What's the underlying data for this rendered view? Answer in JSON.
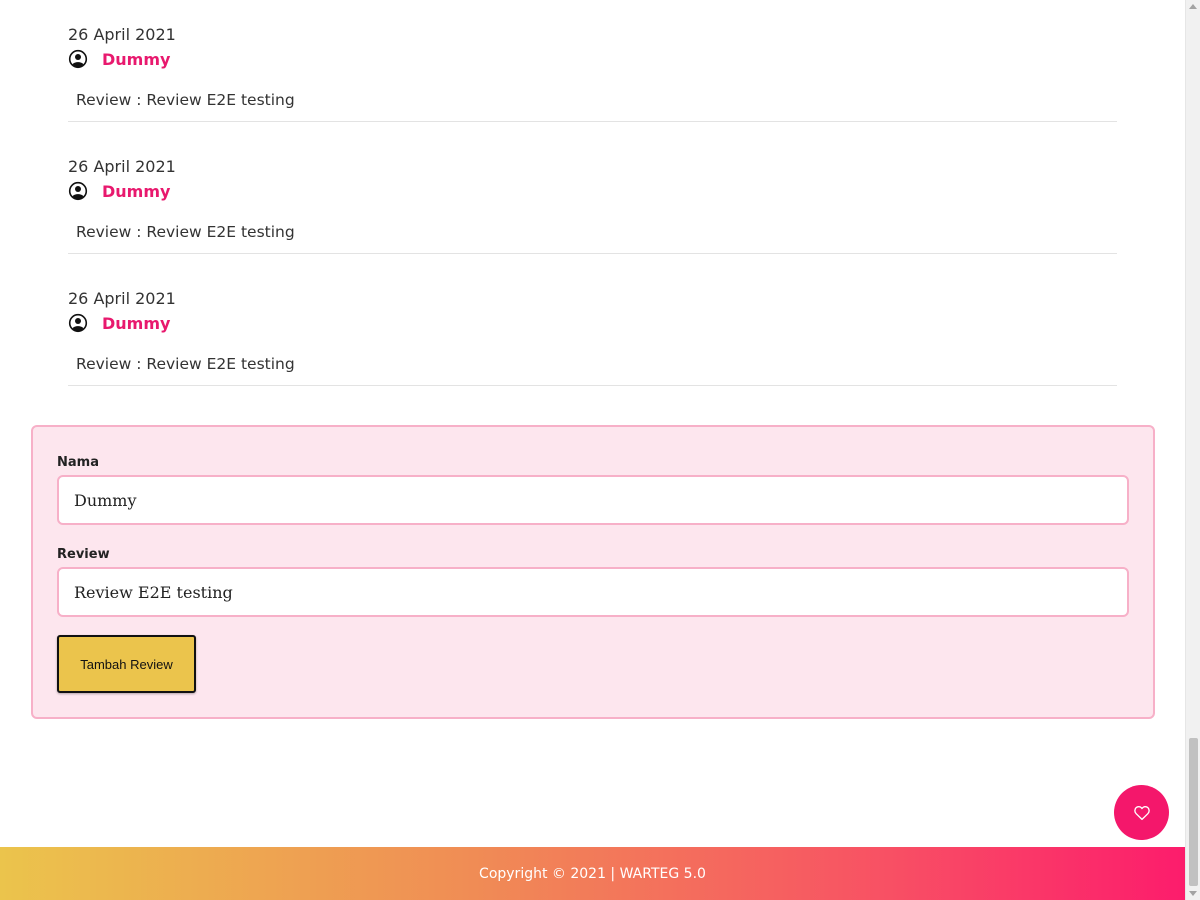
{
  "reviews": [
    {
      "date": "26 April 2021",
      "name": "Dummy",
      "text": "Review : Review E2E testing"
    },
    {
      "date": "26 April 2021",
      "name": "Dummy",
      "text": "Review : Review E2E testing"
    },
    {
      "date": "26 April 2021",
      "name": "Dummy",
      "text": "Review : Review E2E testing"
    }
  ],
  "form": {
    "name_label": "Nama",
    "name_value": "Dummy",
    "review_label": "Review",
    "review_value": "Review E2E testing",
    "submit_label": "Tambah Review"
  },
  "fab": {
    "icon": "heart-icon"
  },
  "footer": {
    "text": "Copyright © 2021 | WARTEG 5.0"
  },
  "colors": {
    "accent": "#e8196e",
    "form_bg": "#fde6ee",
    "form_border": "#f7b0c8",
    "button_bg": "#ebc44c",
    "fab_bg": "#f4176b"
  }
}
